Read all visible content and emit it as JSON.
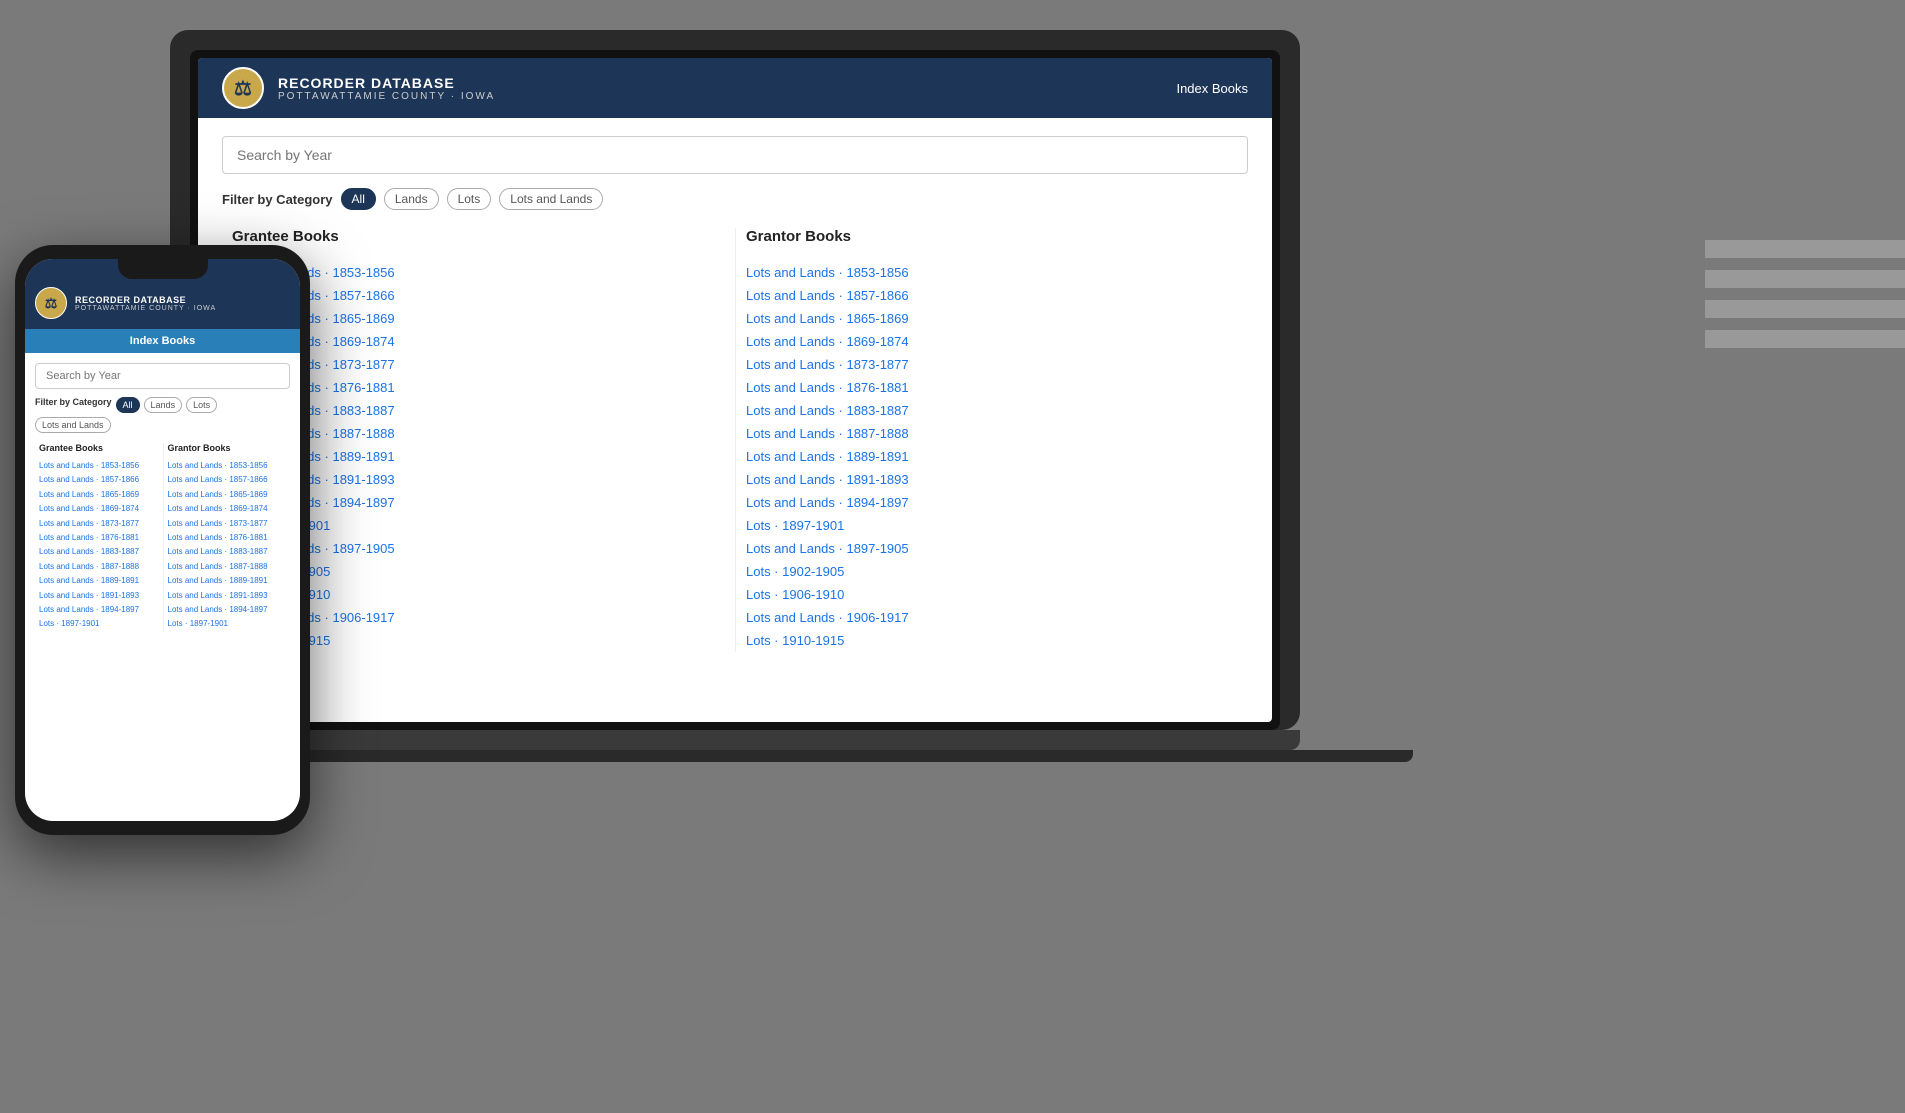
{
  "app": {
    "title": "RECORDER DATABASE",
    "subtitle": "POTTAWATTAMIE COUNTY · IOWA",
    "nav_link": "Index Books",
    "search_placeholder": "Search by Year",
    "filter_label": "Filter by Category",
    "filters": [
      "All",
      "Lands",
      "Lots",
      "Lots and Lands"
    ],
    "active_filter": "All"
  },
  "grantee_books": {
    "title": "Grantee Books",
    "items": [
      "Lots and Lands · 1853-1856",
      "Lots and Lands · 1857-1866",
      "Lots and Lands · 1865-1869",
      "Lots and Lands · 1869-1874",
      "Lots and Lands · 1873-1877",
      "Lots and Lands · 1876-1881",
      "Lots and Lands · 1883-1887",
      "Lots and Lands · 1887-1888",
      "Lots and Lands · 1889-1891",
      "Lots and Lands · 1891-1893",
      "Lots and Lands · 1894-1897",
      "Lots · 1897-1901",
      "Lots and Lands · 1897-1905",
      "Lots · 1902-1905",
      "Lots · 1906-1910",
      "Lots and Lands · 1906-1917",
      "Lots · 1910-1915"
    ]
  },
  "grantor_books": {
    "title": "Grantor Books",
    "items": [
      "Lots and Lands · 1853-1856",
      "Lots and Lands · 1857-1866",
      "Lots and Lands · 1865-1869",
      "Lots and Lands · 1869-1874",
      "Lots and Lands · 1873-1877",
      "Lots and Lands · 1876-1881",
      "Lots and Lands · 1883-1887",
      "Lots and Lands · 1887-1888",
      "Lots and Lands · 1889-1891",
      "Lots and Lands · 1891-1893",
      "Lots and Lands · 1894-1897",
      "Lots · 1897-1901",
      "Lots and Lands · 1897-1905",
      "Lots · 1902-1905",
      "Lots · 1906-1910",
      "Lots and Lands · 1906-1917",
      "Lots · 1910-1915"
    ]
  },
  "phone": {
    "grantee_books": {
      "title": "Grantee Books",
      "items": [
        "Lots and Lands · 1853-1856",
        "Lots and Lands · 1857-1866",
        "Lots and Lands · 1865-1869",
        "Lots and Lands · 1869-1874",
        "Lots and Lands · 1873-1877",
        "Lots and Lands · 1876-1881",
        "Lots and Lands · 1883-1887",
        "Lots and Lands · 1887-1888",
        "Lots and Lands · 1889-1891",
        "Lots and Lands · 1891-1893",
        "Lots and Lands · 1894-1897",
        "Lots · 1897-1901"
      ]
    },
    "grantor_books": {
      "title": "Grantor Books",
      "items": [
        "Lots and Lands · 1853-1856",
        "Lots and Lands · 1857-1866",
        "Lots and Lands · 1865-1869",
        "Lots and Lands · 1869-1874",
        "Lots and Lands · 1873-1877",
        "Lots and Lands · 1876-1881",
        "Lots and Lands · 1883-1887",
        "Lots and Lands · 1887-1888",
        "Lots and Lands · 1889-1891",
        "Lots and Lands · 1891-1893",
        "Lots and Lands · 1894-1897",
        "Lots · 1897-1901"
      ]
    }
  }
}
